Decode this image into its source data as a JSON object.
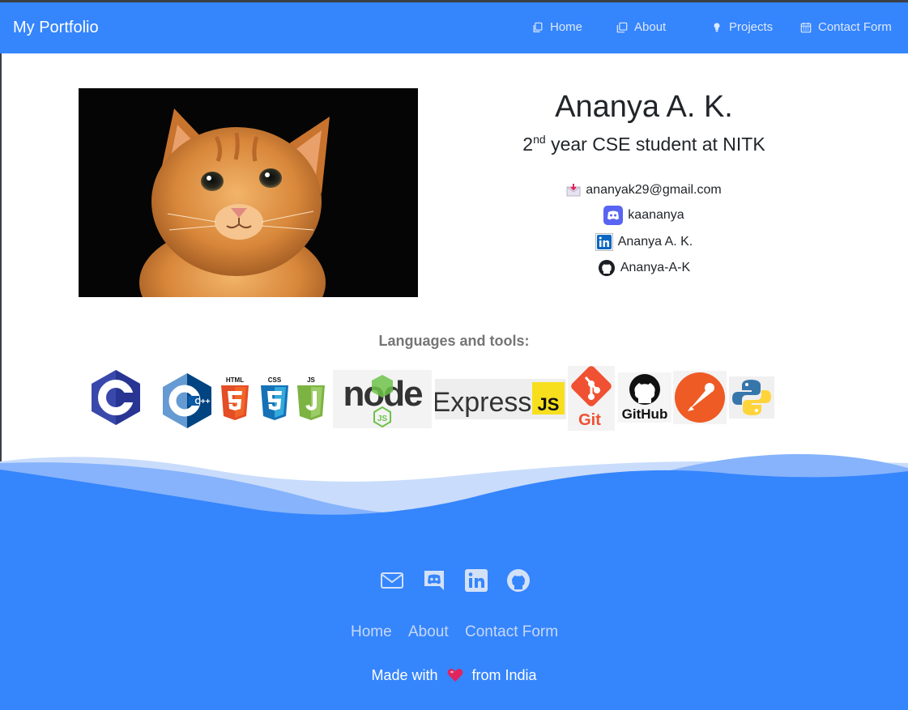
{
  "navbar": {
    "brand": "My Portfolio",
    "items": [
      {
        "label": "Home",
        "icon": "copy-icon"
      },
      {
        "label": "About",
        "icon": "window-icon"
      },
      {
        "label": "Projects",
        "icon": "lightbulb-icon"
      },
      {
        "label": "Contact Form",
        "icon": "calendar-icon"
      }
    ]
  },
  "profile": {
    "photo_alt": "kitten photo",
    "name": "Ananya A. K.",
    "subtitle_ordinal": "2",
    "subtitle_suffix": "nd",
    "subtitle_rest": "year CSE student at NITK",
    "contacts": [
      {
        "icon": "email-icon",
        "text": "ananyak29@gmail.com"
      },
      {
        "icon": "discord-icon",
        "text": "kaananya"
      },
      {
        "icon": "linkedin-icon",
        "text": "Ananya A. K."
      },
      {
        "icon": "github-icon",
        "text": "Ananya-A-K"
      }
    ]
  },
  "tools": {
    "title": "Languages and tools:",
    "logos": [
      {
        "name": "c-logo",
        "label": "C"
      },
      {
        "name": "cpp-logo",
        "label": "C++"
      },
      {
        "name": "html5-logo",
        "label": "HTML"
      },
      {
        "name": "css3-logo",
        "label": "CSS"
      },
      {
        "name": "js-logo",
        "label": "JS"
      },
      {
        "name": "nodejs-logo",
        "label": "node"
      },
      {
        "name": "express-logo",
        "label": "Express",
        "badge": "JS"
      },
      {
        "name": "git-logo",
        "label": "Git"
      },
      {
        "name": "github-logo",
        "label": "GitHub"
      },
      {
        "name": "postman-logo",
        "label": ""
      },
      {
        "name": "python-logo",
        "label": ""
      }
    ]
  },
  "footer": {
    "icons": [
      "email-icon",
      "discord-icon",
      "linkedin-icon",
      "github-icon"
    ],
    "links": [
      "Home",
      "About",
      "Contact Form"
    ],
    "made_prefix": "Made with",
    "made_suffix": "from India"
  },
  "colors": {
    "primary": "#3585fd",
    "nav_text": "#dde8fb",
    "footer_link": "#c7d8f6",
    "heart": "#e0245e"
  }
}
